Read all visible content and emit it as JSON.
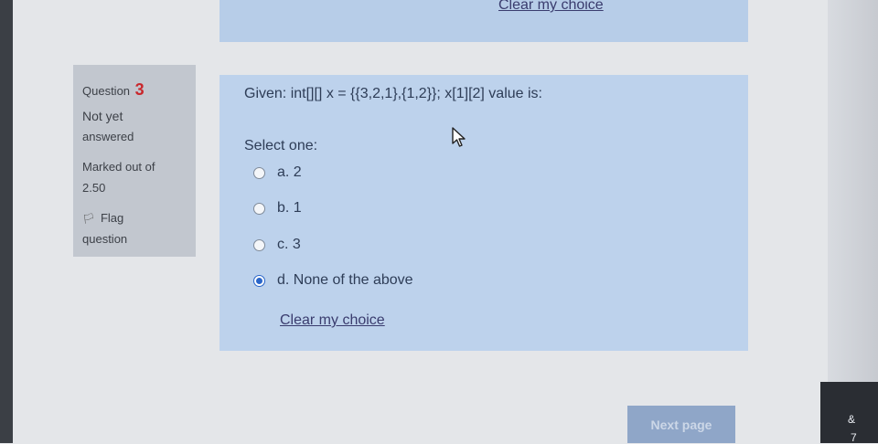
{
  "previous_question": {
    "clear_label": "Clear my choice"
  },
  "question_info": {
    "question_label": "Question",
    "question_number": "3",
    "status_line1": "Not yet",
    "status_line2": "answered",
    "marked_line1": "Marked out of",
    "marked_line2": "2.50",
    "flag_line1": "Flag",
    "flag_line2": "question"
  },
  "question": {
    "text": "Given:  int[][] x = {{3,2,1},{1,2}};   x[1][2] value is:",
    "select_prompt": "Select one:",
    "options": [
      {
        "label": "a. 2",
        "selected": false
      },
      {
        "label": "b. 1",
        "selected": false
      },
      {
        "label": "c. 3",
        "selected": false
      },
      {
        "label": "d. None of the above",
        "selected": true
      }
    ],
    "clear_label": "Clear my choice"
  },
  "navigation": {
    "next_label": "Next page"
  },
  "corner_glyphs": {
    "top": "&",
    "bottom": "7"
  },
  "colors": {
    "accent": "#2a66c9",
    "question_number": "#c9282d",
    "panel": "#bdd2ec"
  }
}
